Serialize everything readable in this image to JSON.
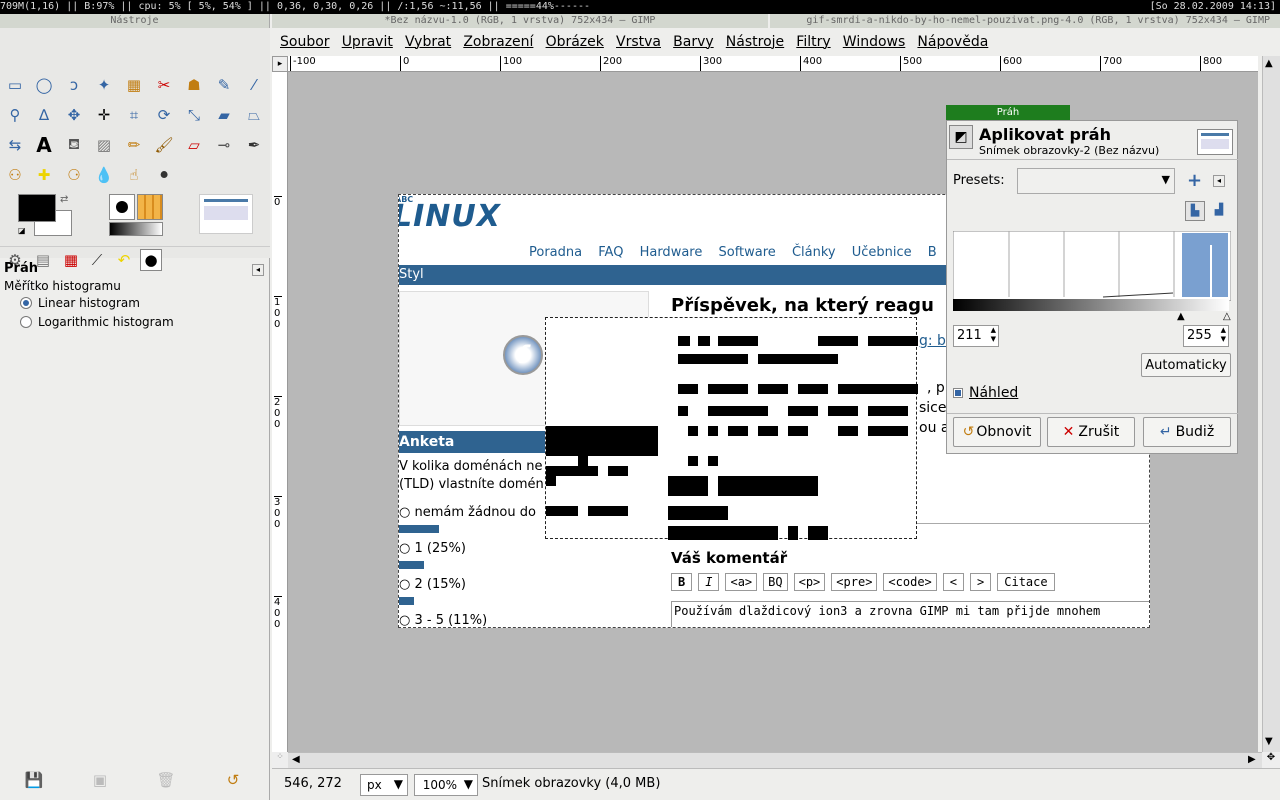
{
  "statusbar": {
    "left": "709M(1,16) || B:97% || cpu: 5% [ 5%, 54% ] || 0,36, 0,30, 0,26 || /:1,56 ~:11,56 || =====44%------",
    "right": "[So 28.02.2009 14:13]"
  },
  "toolbox": {
    "title": "Nástroje",
    "panel_title": "Práh",
    "histogram_scale_label": "Měřítko histogramu",
    "options": [
      "Linear histogram",
      "Logarithmic histogram"
    ]
  },
  "image_window": {
    "title_left": "*Bez názvu-1.0 (RGB, 1 vrstva) 752x434 – GIMP",
    "title_right": "gif-smrdi-a-nikdo-by-ho-nemel-pouzivat.png-4.0 (RGB, 1 vrstva) 752x434 – GIMP",
    "menu": [
      "Soubor",
      "Upravit",
      "Vybrat",
      "Zobrazení",
      "Obrázek",
      "Vrstva",
      "Barvy",
      "Nástroje",
      "Filtry",
      "Windows",
      "Nápověda"
    ],
    "hruler_ticks": [
      "-100",
      "0",
      "100",
      "200",
      "300",
      "400",
      "500",
      "600",
      "700",
      "800"
    ],
    "vruler_ticks": [
      "0",
      "1 0 0",
      "2 0 0",
      "3 0 0",
      "4 0 0"
    ],
    "coords": "546, 272",
    "unit": "px",
    "zoom": "100%",
    "status": "Snímek obrazovky (4,0 MB)"
  },
  "page": {
    "logo": "LINUX",
    "logo_prefix": "ABC",
    "nav": [
      "Poradna",
      "FAQ",
      "Hardware",
      "Software",
      "Články",
      "Učebnice",
      "B"
    ],
    "styl": "Styl",
    "heading": "Příspěvek, na který reagu",
    "anketa": "Anketa",
    "question_1": "V kolika doménách ne",
    "question_2": "(TLD) vlastníte domén",
    "answers": [
      "nemám žádnou do",
      "1 (25%)",
      "2 (15%)",
      "3 - 5 (11%)"
    ],
    "answer_bars": [
      0.4,
      0.25,
      0.15,
      0.11
    ],
    "comment_title": "Váš komentář",
    "toolbar": [
      "B",
      "I",
      "<a>",
      "BQ",
      "<p>",
      "<pre>",
      "<code>",
      "<",
      ">",
      "Citace"
    ],
    "textarea": "Používám dlaždicový ion3 a zrovna GIMP mi tam přijde mnohem",
    "link_fragment": "g: bl",
    "text_fragments": [
      ", pr",
      "sice",
      "ou a"
    ]
  },
  "dialog": {
    "tab": "Práh",
    "title": "Aplikovat práh",
    "subtitle": "Snímek obrazovky-2 (Bez názvu)",
    "presets_label": "Presets:",
    "low": "211",
    "high": "255",
    "auto": "Automaticky",
    "preview": "Náhled",
    "reset": "Obnovit",
    "cancel": "Zrušit",
    "ok": "Budiž"
  }
}
